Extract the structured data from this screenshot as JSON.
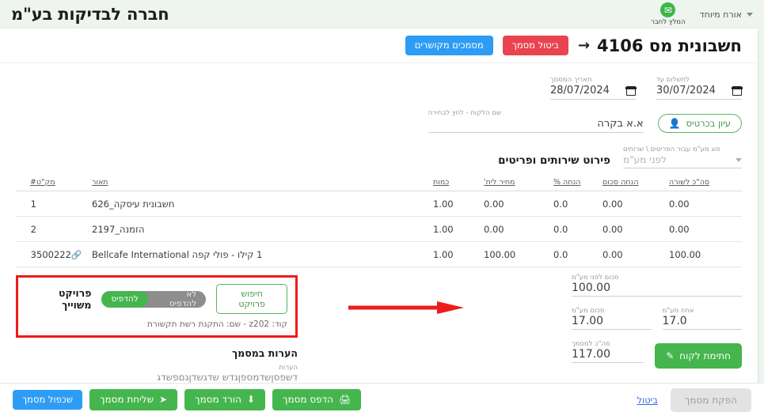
{
  "topbar": {
    "company_title": "חברה לבדיקות בע\"מ",
    "refer_label": "המלץ לחבר",
    "refer_icon": "whatsapp-icon",
    "user_label": "אורח מיוחד"
  },
  "doc_header": {
    "back_icon": "back-arrow-icon",
    "title": "חשבונית מס 4106",
    "cancel_doc_label": "ביטול מסמך",
    "linked_docs_label": "מסמכים מקושרים"
  },
  "dates": {
    "due_label": "לתשלום עד",
    "due_value": "30/07/2024",
    "doc_date_label": "תאריך המסמך",
    "doc_date_value": "28/07/2024",
    "calendar_icon": "calendar-icon"
  },
  "customer": {
    "label": "שם הלקוח -  לחץ לבחירה",
    "value": "א.א בקרה",
    "card_button": "עיון בכרטיס",
    "card_icon": "person-icon"
  },
  "items_section": {
    "title": "פירוט שירותים ופריטים",
    "vat_type_label": "סוג מע\"מ עבור הפריטים \\ שרותים",
    "vat_type_value": "לפני מע\"מ"
  },
  "table": {
    "headers": {
      "num": "#",
      "sku": "מק\"ט",
      "desc": "תאור",
      "qty": "כמות",
      "price": "מחיר ליח'",
      "discount_pct": "הנחה %",
      "discount_sum": "הנחה סכום",
      "row_total": "סה\"כ לשורה"
    },
    "rows": [
      {
        "num": "1",
        "sku": "",
        "has_link": false,
        "desc": "חשבונית עיסקה_626",
        "qty": "1.00",
        "price": "0.00",
        "discount_pct": "0.0",
        "discount_sum": "0.00",
        "row_total": "0.00"
      },
      {
        "num": "2",
        "sku": "",
        "has_link": false,
        "desc": "הזמנה_2197",
        "qty": "1.00",
        "price": "0.00",
        "discount_pct": "0.0",
        "discount_sum": "0.00",
        "row_total": "0.00"
      },
      {
        "num": "3",
        "sku": "500222",
        "has_link": true,
        "desc": "1 קילו - פולי קפה Bellcafe International",
        "qty": "1.00",
        "price": "100.00",
        "discount_pct": "0.0",
        "discount_sum": "0.00",
        "row_total": "100.00"
      }
    ]
  },
  "project": {
    "label": "פרויקט משוייך",
    "toggle_on": "להדפיס",
    "toggle_off": "לא להדפיס",
    "toggle_selected": "להדפיס",
    "search_button": "חיפוש פרויקט",
    "details": "קוד: z202 - שם: התקנת רשת תקשורת",
    "highlight_color": "#ee1b1b"
  },
  "notes": {
    "title": "הערות במסמך",
    "label": "הערות",
    "value": "דשפסןשדמספןגדש שדגשדןגםפשדג"
  },
  "totals": {
    "before_vat_label": "סכום לפני מע\"מ",
    "before_vat_value": "100.00",
    "vat_pct_label": "אחוז מע\"מ",
    "vat_pct_value": "17.0",
    "vat_sum_label": "סכום מע\"מ",
    "vat_sum_value": "17.00",
    "doc_total_label": "סה\"כ למסמך",
    "doc_total_value": "117.00",
    "signature_button": "חתימת לקוח",
    "signature_icon": "pencil-icon"
  },
  "footer": {
    "duplicate_label": "שכפול מסמך",
    "send_label": "שליחת מסמך",
    "send_icon": "send-icon",
    "download_label": "הורד מסמך",
    "download_icon": "download-icon",
    "print_label": "הדפס מסמך",
    "print_icon": "printer-icon",
    "cancel_link": "ביטול",
    "issue_label": "הפקת מסמך"
  },
  "annotation": {
    "arrow_icon": "red-arrow-right",
    "color": "#ee1b1b"
  }
}
